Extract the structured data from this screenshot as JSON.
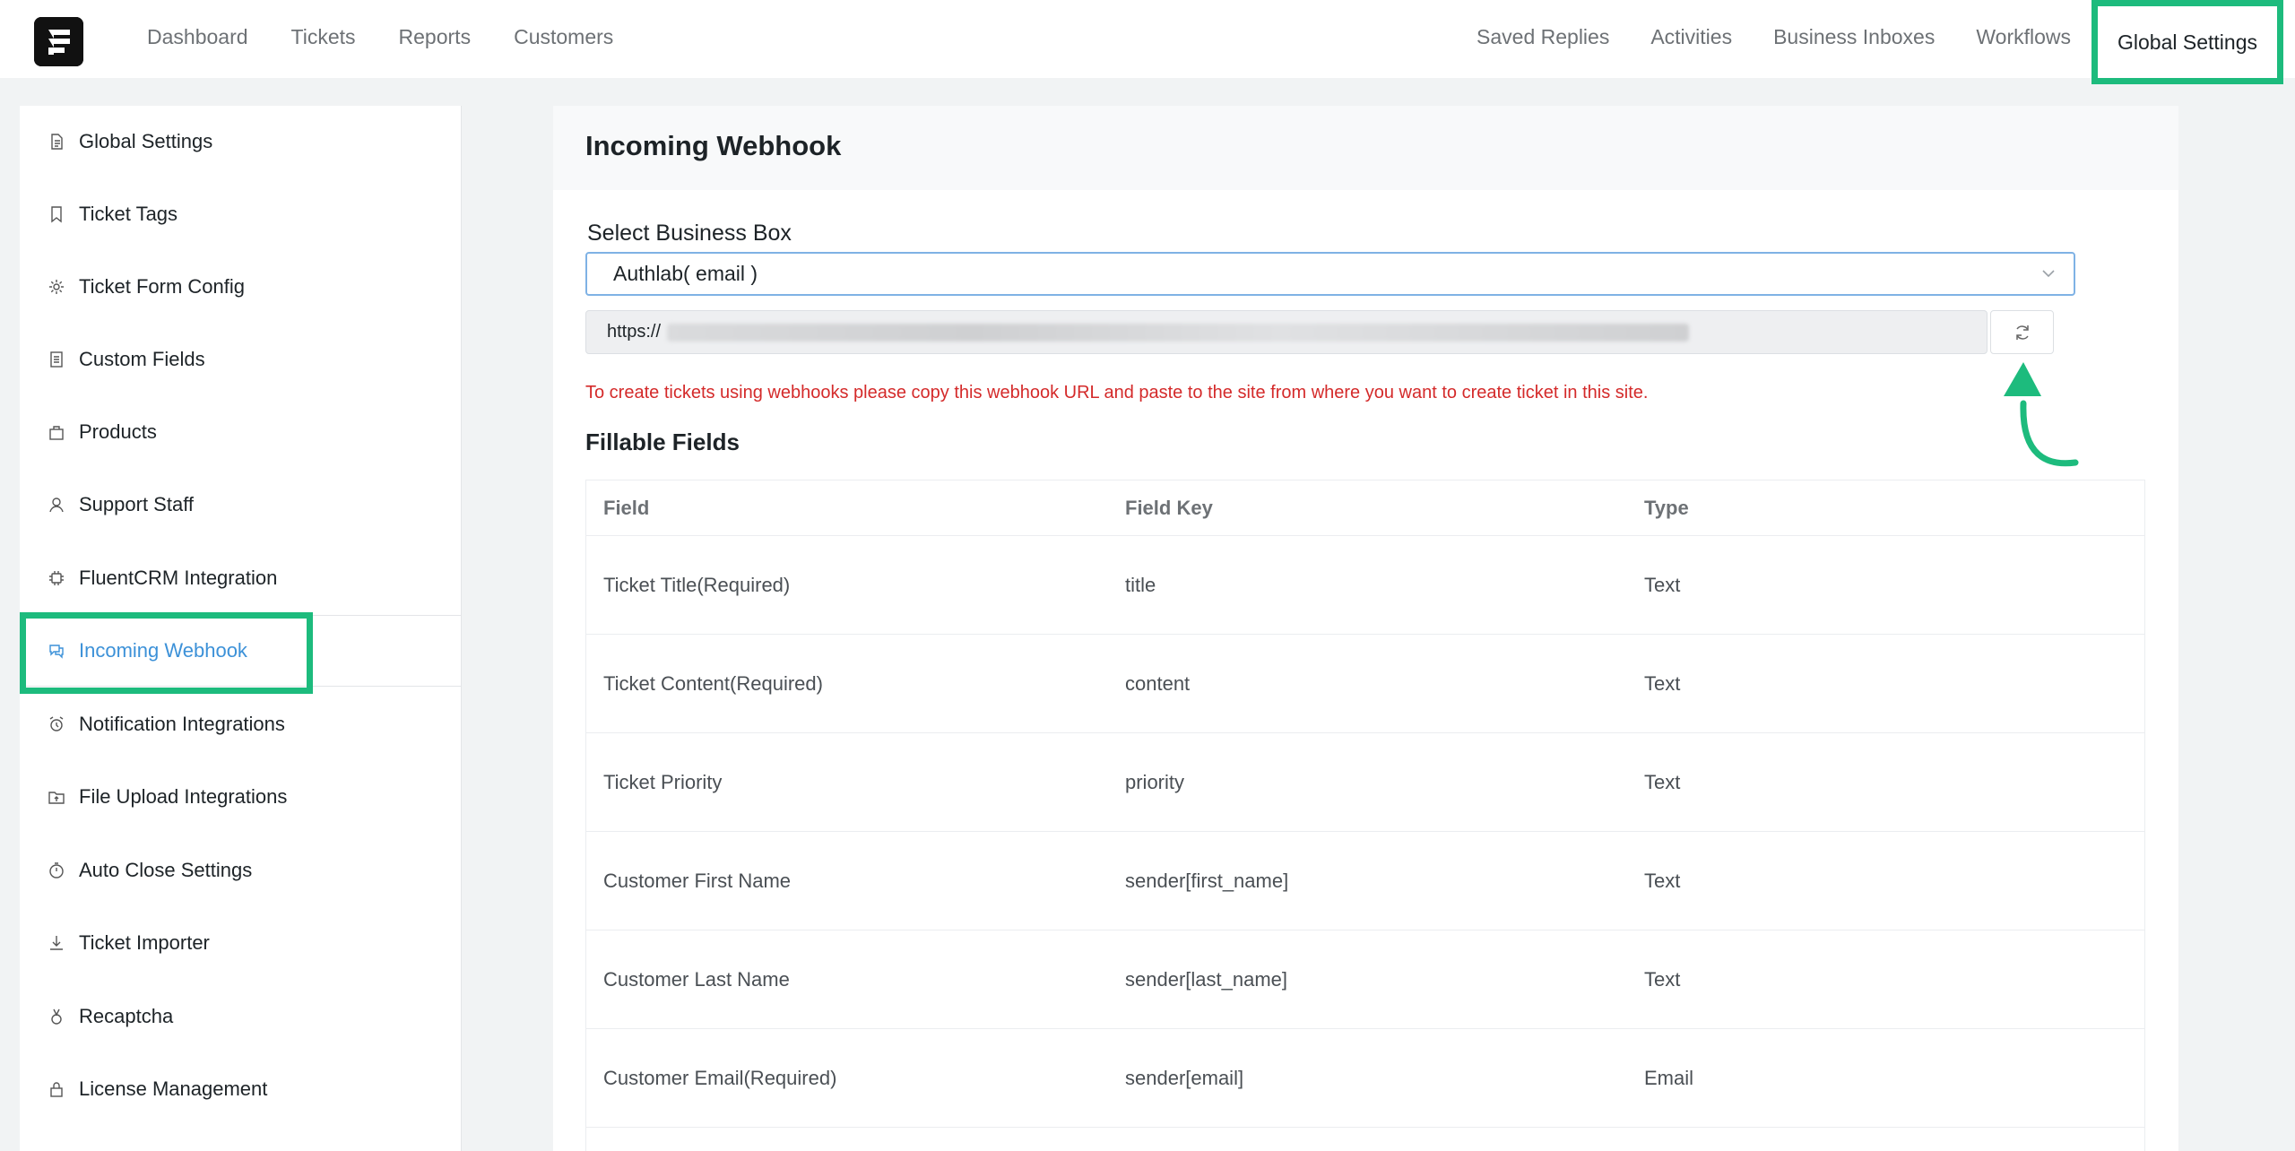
{
  "nav": {
    "left": [
      "Dashboard",
      "Tickets",
      "Reports",
      "Customers"
    ],
    "right": [
      "Saved Replies",
      "Activities",
      "Business Inboxes",
      "Workflows",
      "Global Settings"
    ],
    "active": "Global Settings"
  },
  "sidebar": {
    "items": [
      {
        "label": "Global Settings",
        "icon": "document-icon"
      },
      {
        "label": "Ticket Tags",
        "icon": "bookmark-icon"
      },
      {
        "label": "Ticket Form Config",
        "icon": "gear-icon"
      },
      {
        "label": "Custom Fields",
        "icon": "list-icon"
      },
      {
        "label": "Products",
        "icon": "bag-icon"
      },
      {
        "label": "Support Staff",
        "icon": "user-icon"
      },
      {
        "label": "FluentCRM Integration",
        "icon": "chip-icon"
      },
      {
        "label": "Incoming Webhook",
        "icon": "chat-icon"
      },
      {
        "label": "Notification Integrations",
        "icon": "alarm-icon"
      },
      {
        "label": "File Upload Integrations",
        "icon": "folder-icon"
      },
      {
        "label": "Auto Close Settings",
        "icon": "timer-icon"
      },
      {
        "label": "Ticket Importer",
        "icon": "download-icon"
      },
      {
        "label": "Recaptcha",
        "icon": "medal-icon"
      },
      {
        "label": "License Management",
        "icon": "lock-icon"
      }
    ],
    "active_index": 7
  },
  "panel": {
    "title": "Incoming Webhook",
    "select_label": "Select Business Box",
    "select_value": "Authlab( email )",
    "webhook_url_prefix": "https://",
    "hint": "To create tickets using webhooks please copy this webhook URL and paste to the site from where you want to create ticket in this site.",
    "fillable_title": "Fillable Fields"
  },
  "table": {
    "headers": [
      "Field",
      "Field Key",
      "Type"
    ],
    "rows": [
      [
        "Ticket Title(Required)",
        "title",
        "Text"
      ],
      [
        "Ticket Content(Required)",
        "content",
        "Text"
      ],
      [
        "Ticket Priority",
        "priority",
        "Text"
      ],
      [
        "Customer First Name",
        "sender[first_name]",
        "Text"
      ],
      [
        "Customer Last Name",
        "sender[last_name]",
        "Text"
      ],
      [
        "Customer Email(Required)",
        "sender[email]",
        "Email"
      ]
    ]
  },
  "colors": {
    "highlight": "#1dbb7d",
    "active_link": "#3c91d8",
    "hint_red": "#d42a2a"
  }
}
